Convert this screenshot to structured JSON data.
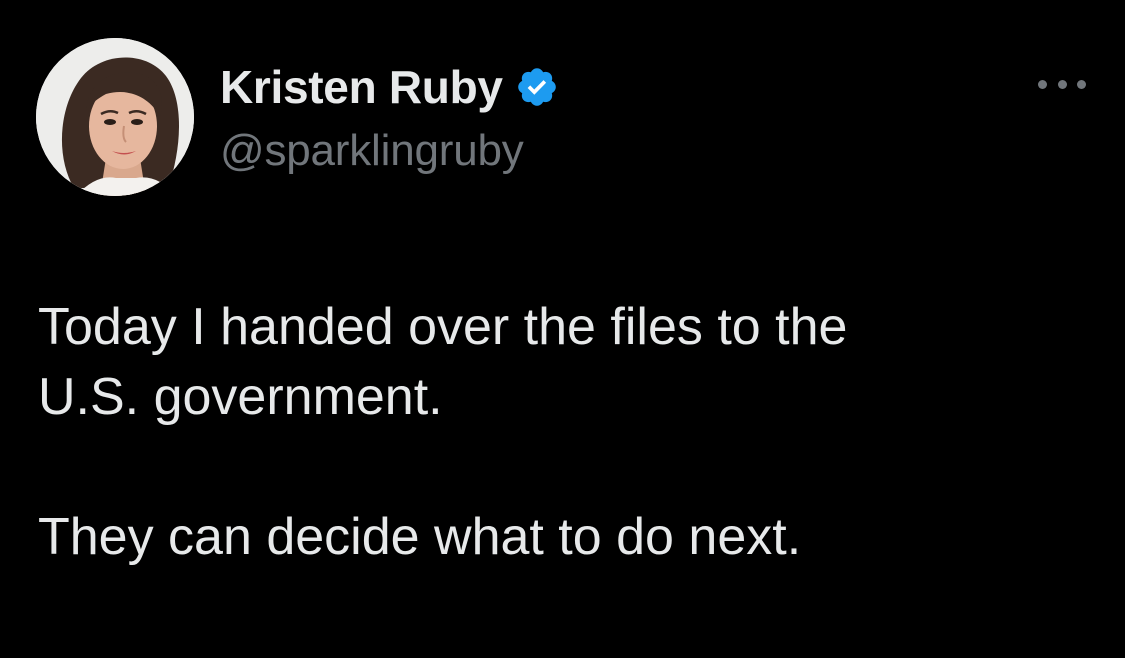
{
  "author": {
    "display_name": "Kristen Ruby",
    "handle": "@sparklingruby",
    "verified": true,
    "verified_color": "#1d9bf0",
    "avatar_icon": "profile-photo"
  },
  "menu": {
    "more_icon": "more-options-icon"
  },
  "tweet": {
    "lines": [
      "Today I handed over the files to the",
      "U.S. government.",
      "They can decide what to do next."
    ]
  },
  "colors": {
    "background": "#000000",
    "primary_text": "#e7e9ea",
    "secondary_text": "#71767b"
  }
}
